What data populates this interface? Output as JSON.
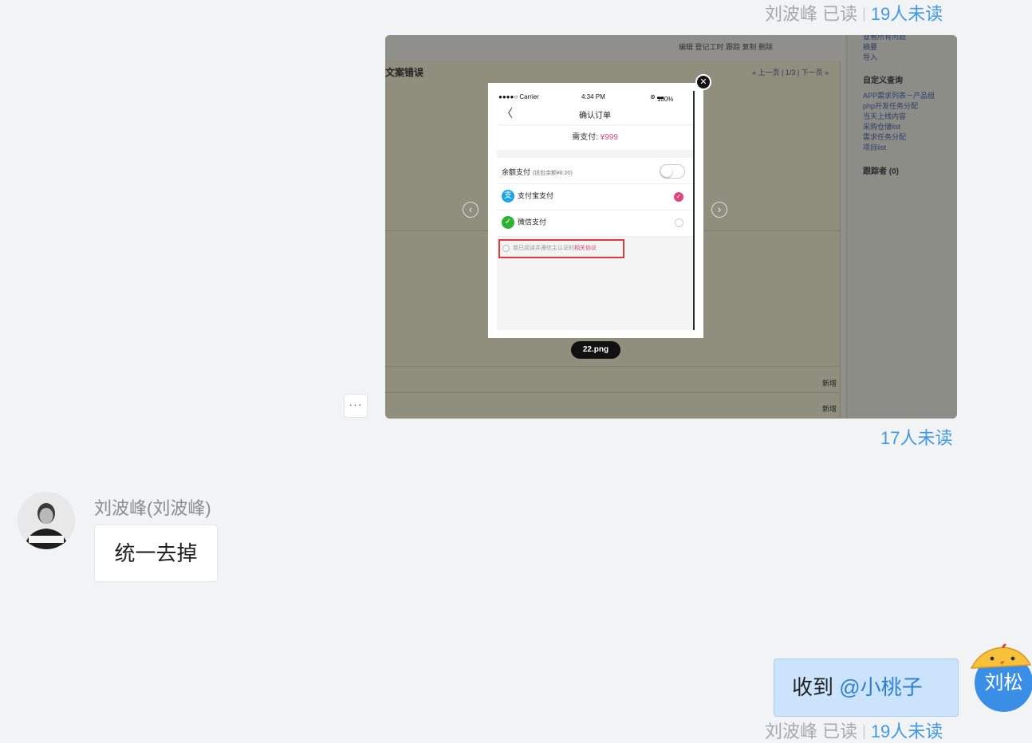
{
  "messages": {
    "top_status": {
      "reader": "刘波峰 已读",
      "separator": "|",
      "unread": "19人未读"
    },
    "image_message": {
      "file_name": "22.png",
      "unread": "17人未读",
      "more_label": "···",
      "embedded": {
        "toolbar": "编辑  登记工时  跟踪  复制  删除",
        "title": "文案错误",
        "pager": "« 上一页 | 1/3 | 下一页 »",
        "side_top": [
          "查看所有问题",
          "摘要",
          "导入"
        ],
        "side_query_title": "自定义查询",
        "side_queries": [
          "APP需求列表－产品组",
          "php开发任务分配",
          "当天上线内容",
          "采购仓储list",
          "需求任务分配",
          "项目list"
        ],
        "followers": "跟踪者 (0)",
        "new_label": "新增",
        "phone": {
          "carrier": "●●●●○ Carrier",
          "time": "4:34 PM",
          "battery": "100%",
          "back": "〈",
          "title": "确认订单",
          "pay_label": "需支付:",
          "pay_amount": "¥999",
          "balance_label": "余额支付",
          "balance_note": "(钱包余额¥8.00)",
          "alipay_label": "支付宝支付",
          "wechat_label": "微信支付",
          "agree_text": "我已阅读并遵信主认证的",
          "agree_link": "相关协议"
        }
      }
    },
    "received": {
      "sender": "刘波峰(刘波峰)",
      "text": "统一去掉"
    },
    "sent": {
      "text": "收到",
      "mention": "@小桃子",
      "avatar_text": "刘松"
    }
  },
  "colors": {
    "unread": "#3f99e6",
    "sent_bubble": "#cce4fb",
    "background": "#f2f3f5"
  }
}
